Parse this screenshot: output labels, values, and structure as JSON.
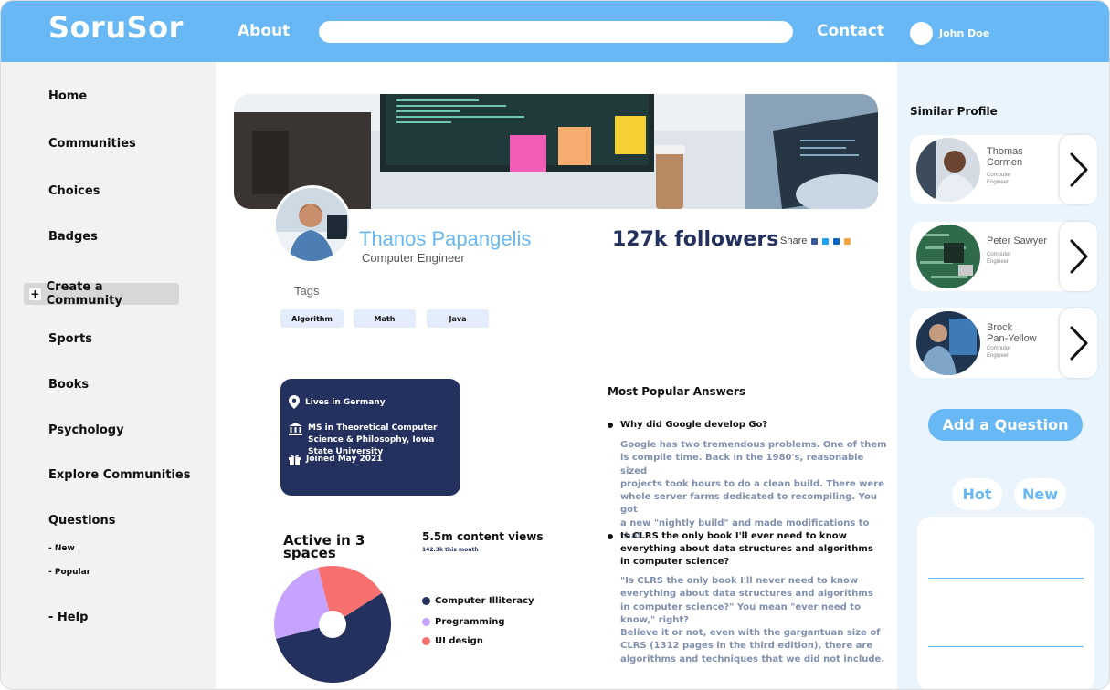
{
  "header": {
    "logo": "SoruSor",
    "nav_about": "About",
    "search_placeholder": "",
    "nav_contact": "Contact",
    "user_name": "John Doe"
  },
  "sidebar": {
    "items": [
      {
        "label": "Home"
      },
      {
        "label": "Communities"
      },
      {
        "label": "Choices"
      },
      {
        "label": "Badges"
      },
      {
        "label": "Create a Community"
      },
      {
        "label": "Sports"
      },
      {
        "label": "Books"
      },
      {
        "label": "Psychology"
      },
      {
        "label": "Explore Communities"
      },
      {
        "label": "Questions"
      },
      {
        "label": "- New"
      },
      {
        "label": "- Popular"
      },
      {
        "label": "- Help"
      }
    ]
  },
  "profile": {
    "name": "Thanos Papangelis",
    "role": "Computer Engineer",
    "followers": "127k followers",
    "share_label": "Share",
    "tags_title": "Tags",
    "tags": [
      "Algorithm",
      "Math",
      "Java"
    ],
    "info": {
      "lives": "Lives in Germany",
      "education": "MS in Theoretical Computer Science & Philosophy, Iowa State University",
      "joined": "Joined May 2021"
    },
    "active_title": "Active in 3 spaces",
    "views": "5.5m content views",
    "views_sub": "142.3k this month"
  },
  "colors": {
    "accent": "#67b8f4",
    "navy": "#24305e",
    "purple": "#c5a3ff",
    "coral": "#f7706f",
    "facebook": "#3b5998",
    "twitter": "#1da1f2",
    "linkedin": "#0a66c2",
    "other": "#f2a640"
  },
  "share_icons": [
    "facebook-icon",
    "twitter-icon",
    "linkedin-icon",
    "rss-icon"
  ],
  "chart_data": {
    "type": "pie",
    "donut": true,
    "slices": [
      {
        "label": "Computer Illiteracy",
        "value": 55,
        "color": "#24305e"
      },
      {
        "label": "Programming",
        "value": 25,
        "color": "#c5a3ff"
      },
      {
        "label": "UI design",
        "value": 20,
        "color": "#f7706f"
      }
    ]
  },
  "answers": {
    "title": "Most Popular Answers",
    "items": [
      {
        "question": "Why did Google develop Go?",
        "answer": "Google has two tremendous problems. One of them\nis compile time. Back in the 1980's, reasonable sized\nprojects took hours to do a clean build. There were\nwhole server farms dedicated to recompiling. You got\na new \"nightly build\" and made modifications to that."
      },
      {
        "question": "Is CLRS the only book I'll ever need to know\neverything about data structures and algorithms\nin computer science?",
        "answer": "\"Is CLRS the only book I'll never need to know\neverything about data structures and algorithms\nin computer science?\" You mean \"ever need to\nknow,\" right?\nBelieve it or not, even with the gargantuan size of\nCLRS (1312 pages in the third edition), there are\nalgorithms and techniques that we did not include."
      }
    ]
  },
  "right": {
    "similar_title": "Similar Profile",
    "profiles": [
      {
        "name": "Thomas\nCormen",
        "role": "Computer\nEngineer"
      },
      {
        "name": "Peter Sawyer",
        "role": "Computer\nEngineer"
      },
      {
        "name": "Brock\nPan-Yellow",
        "role": "Computer\nEngineer"
      }
    ],
    "add_question": "Add a Question",
    "hot": "Hot",
    "new": "New"
  }
}
